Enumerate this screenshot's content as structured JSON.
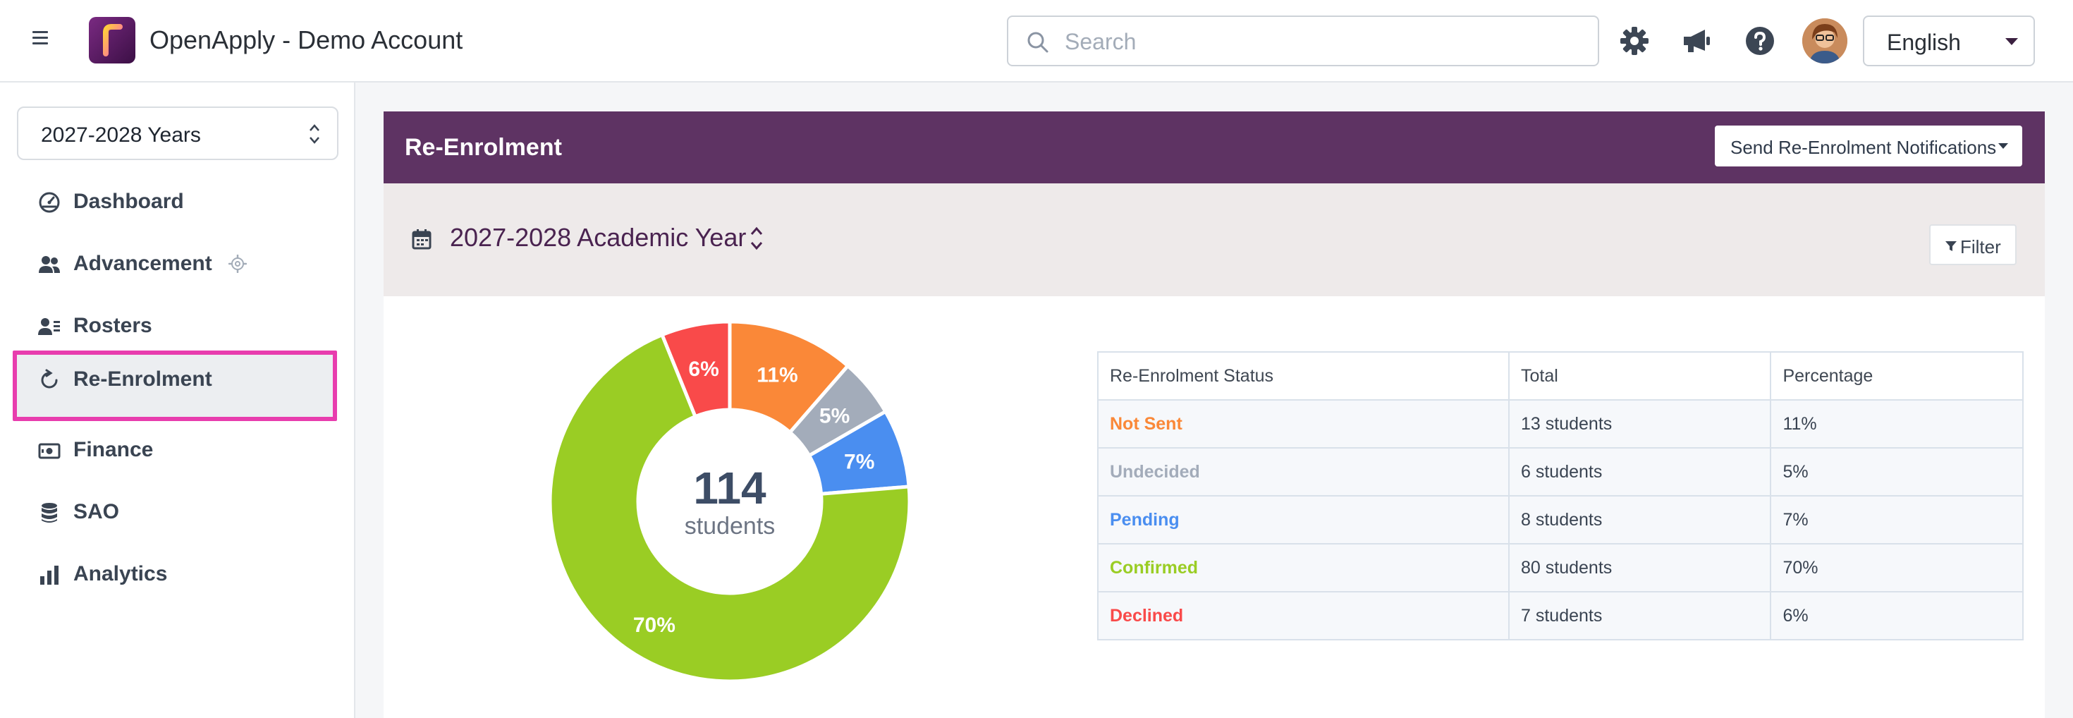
{
  "app": {
    "title": "OpenApply - Demo Account"
  },
  "search": {
    "placeholder": "Search"
  },
  "header": {
    "icons": [
      "gear-icon",
      "megaphone-icon",
      "help-icon",
      "avatar"
    ],
    "language": "English"
  },
  "sidebar": {
    "year_select": "2027-2028 Years",
    "items": [
      {
        "label": "Dashboard",
        "icon": "dashboard-gauge-icon"
      },
      {
        "label": "Advancement",
        "icon": "users-icon"
      },
      {
        "label": "Rosters",
        "icon": "roster-icon"
      },
      {
        "label": "Re-Enrolment",
        "icon": "refresh-icon",
        "active": true
      },
      {
        "label": "Finance",
        "icon": "money-icon"
      },
      {
        "label": "SAO",
        "icon": "database-icon"
      },
      {
        "label": "Analytics",
        "icon": "bar-chart-icon"
      }
    ]
  },
  "page": {
    "title": "Re-Enrolment",
    "notify_button": "Send Re-Enrolment Notifications",
    "academic_year": "2027-2028 Academic Year",
    "filter_button": "Filter"
  },
  "colors": {
    "header_purple": "#5e3363",
    "highlight_pink": "#e83dae",
    "not_sent": "#fa8838",
    "undecided": "#a3acba",
    "pending": "#4a8ef0",
    "confirmed": "#9acd24",
    "declined": "#f94a4a"
  },
  "chart_data": {
    "type": "pie",
    "variant": "donut",
    "center_value": "114",
    "center_label": "students",
    "slices": [
      {
        "name": "Not Sent",
        "value": 13,
        "label": "11%",
        "color": "#fa8838"
      },
      {
        "name": "Undecided",
        "value": 6,
        "label": "5%",
        "color": "#a3acba"
      },
      {
        "name": "Pending",
        "value": 8,
        "label": "7%",
        "color": "#4a8ef0"
      },
      {
        "name": "Confirmed",
        "value": 80,
        "label": "70%",
        "color": "#9acd24"
      },
      {
        "name": "Declined",
        "value": 7,
        "label": "6%",
        "color": "#f94a4a"
      }
    ]
  },
  "table": {
    "headers": [
      "Re-Enrolment Status",
      "Total",
      "Percentage"
    ],
    "rows": [
      {
        "status": "Not Sent",
        "total": "13 students",
        "pct": "11%",
        "color": "#fa8838"
      },
      {
        "status": "Undecided",
        "total": "6 students",
        "pct": "5%",
        "color": "#a3acba"
      },
      {
        "status": "Pending",
        "total": "8 students",
        "pct": "7%",
        "color": "#4a8ef0"
      },
      {
        "status": "Confirmed",
        "total": "80 students",
        "pct": "70%",
        "color": "#9acd24"
      },
      {
        "status": "Declined",
        "total": "7 students",
        "pct": "6%",
        "color": "#f94a4a"
      }
    ]
  }
}
